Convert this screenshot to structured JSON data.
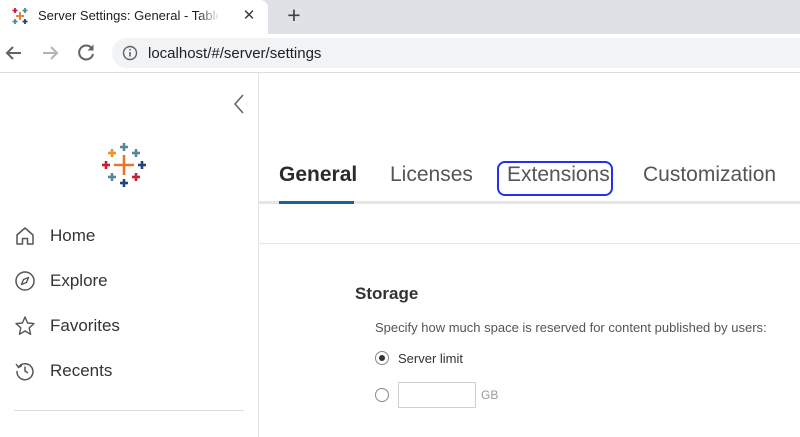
{
  "browser": {
    "tab_title": "Server Settings: General - Tableau",
    "new_tab_symbol": "+",
    "close_symbol": "✕",
    "url": "localhost/#/server/settings"
  },
  "sidebar": {
    "items": [
      {
        "label": "Home",
        "icon": "home-icon"
      },
      {
        "label": "Explore",
        "icon": "compass-icon"
      },
      {
        "label": "Favorites",
        "icon": "star-icon"
      },
      {
        "label": "Recents",
        "icon": "history-icon"
      }
    ]
  },
  "settings_tabs": [
    {
      "label": "General",
      "active": true
    },
    {
      "label": "Licenses",
      "active": false
    },
    {
      "label": "Extensions",
      "active": false,
      "highlighted": true
    },
    {
      "label": "Customization",
      "active": false
    }
  ],
  "storage": {
    "title": "Storage",
    "description": "Specify how much space is reserved for content published by users:",
    "option_server_limit": "Server limit",
    "server_limit_selected": true,
    "custom_value": "",
    "unit": "GB"
  },
  "colors": {
    "active_tab_underline": "#1f5f99",
    "highlight_box": "#2233e6"
  }
}
